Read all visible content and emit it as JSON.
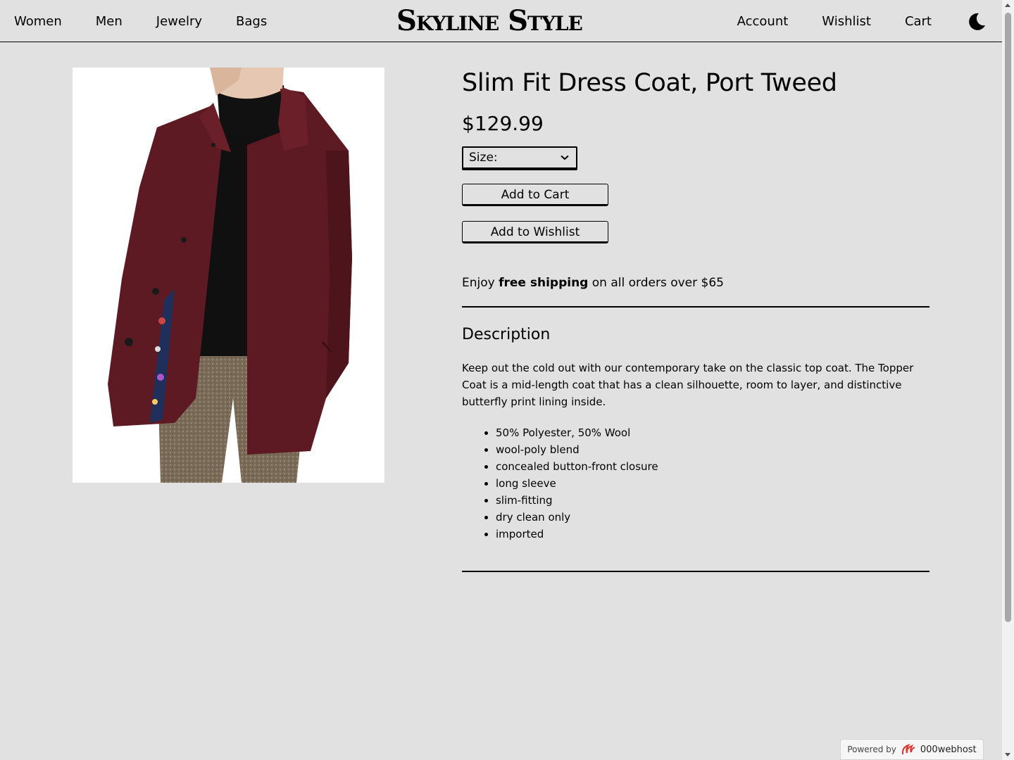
{
  "header": {
    "nav_left": [
      "Women",
      "Men",
      "Jewelry",
      "Bags"
    ],
    "logo": "Skyline Style",
    "nav_right": [
      "Account",
      "Wishlist",
      "Cart"
    ],
    "theme_toggle_icon": "moon-icon"
  },
  "product": {
    "image_alt": "Model wearing a burgundy slim fit dress coat over a black turtleneck with tweed trousers",
    "title": "Slim Fit Dress Coat, Port Tweed",
    "price": "$129.99",
    "size_label": "Size:",
    "add_to_cart": "Add to Cart",
    "add_to_wishlist": "Add to Wishlist",
    "shipping": {
      "prefix": "Enjoy",
      "bold": "free shipping",
      "suffix": "on all orders over $65"
    },
    "description_heading": "Description",
    "description_text": "Keep out the cold out with our contemporary take on the classic top coat. The Topper Coat is a mid-length coat that has a clean silhouette, room to layer, and distinctive butterfly print lining inside.",
    "features": [
      "50% Polyester, 50% Wool",
      "wool-poly blend",
      "concealed button-front closure",
      "long sleeve",
      "slim-fitting",
      "dry clean only",
      "imported"
    ]
  },
  "footer": {
    "powered_by": "Powered by",
    "host_brand": "000webhost"
  },
  "colors": {
    "background": "#e1e1e1",
    "coat": "#5e1a22",
    "text": "#000000"
  }
}
